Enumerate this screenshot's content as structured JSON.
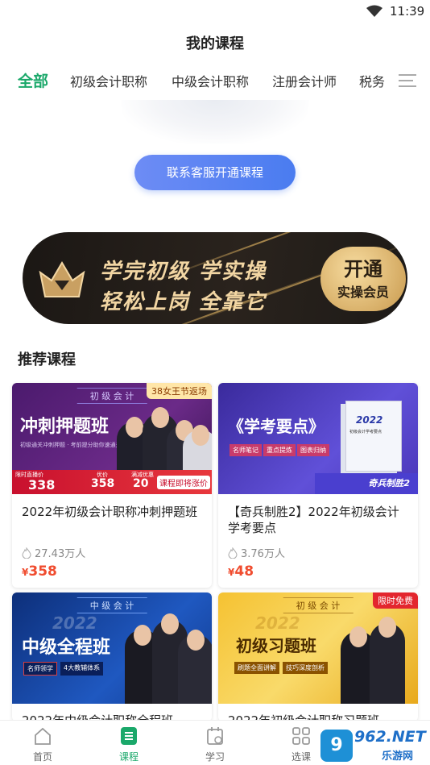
{
  "status": {
    "time": "11:39"
  },
  "header": {
    "title": "我的课程"
  },
  "tabs": [
    {
      "label": "全部"
    },
    {
      "label": "初级会计职称"
    },
    {
      "label": "中级会计职称"
    },
    {
      "label": "注册会计师"
    },
    {
      "label": "税务"
    }
  ],
  "empty": {
    "button_label": "联系客服开通课程"
  },
  "banner": {
    "line1": "学完初级 学实操",
    "line2": "轻松上岗 全靠它",
    "seal_top": "开通",
    "seal_bottom": "实操会员"
  },
  "section": {
    "title": "推荐课程"
  },
  "courses": [
    {
      "title": "2022年初级会计职称冲刺押题班",
      "views": "27.43万人",
      "currency": "¥",
      "price": "358",
      "thumb": {
        "tag": "初 级 会 计",
        "headline": "冲刺押题班",
        "badge": "38女王节返场",
        "sub": "初级通关冲刺押题 · 考前提分助你速通关",
        "p1": "338",
        "p1_label": "限时直播价",
        "p2": "358",
        "p2_label": "优价",
        "p3": "20",
        "p3_label": "满减优惠",
        "notice": "课程即将涨价"
      }
    },
    {
      "title": "【奇兵制胜2】2022年初级会计学考要点",
      "views": "3.76万人",
      "currency": "¥",
      "price": "48",
      "thumb": {
        "headline": "《学考要点》",
        "chips": [
          "名师笔记",
          "重点提炼",
          "图表归纳"
        ],
        "brand": "奇兵制胜2",
        "book": "2022",
        "book_sub": "初级会计学考要点"
      }
    },
    {
      "title": "2022年中级会计职称全程班",
      "thumb": {
        "tag": "中 级 会 计",
        "year": "2022",
        "headline": "中级全程班",
        "chips": [
          "名师领学",
          "4大教辅体系"
        ]
      }
    },
    {
      "title": "2022年初级会计职称习题班",
      "thumb": {
        "tag": "初 级 会 计",
        "year": "2022",
        "headline": "初级习题班",
        "badge": "限时免费",
        "chips": [
          "刷题全面讲解",
          "技巧深度剖析"
        ]
      }
    }
  ],
  "nav": [
    {
      "label": "首页",
      "icon": "home-icon"
    },
    {
      "label": "课程",
      "icon": "course-icon"
    },
    {
      "label": "学习",
      "icon": "calendar-icon"
    },
    {
      "label": "选课",
      "icon": "grid-icon"
    }
  ],
  "watermark": {
    "text": "962.NET",
    "sub": "乐游网"
  },
  "colors": {
    "accent": "#1aa86a",
    "button": "#4a7cf0",
    "price": "#f04c2f"
  }
}
